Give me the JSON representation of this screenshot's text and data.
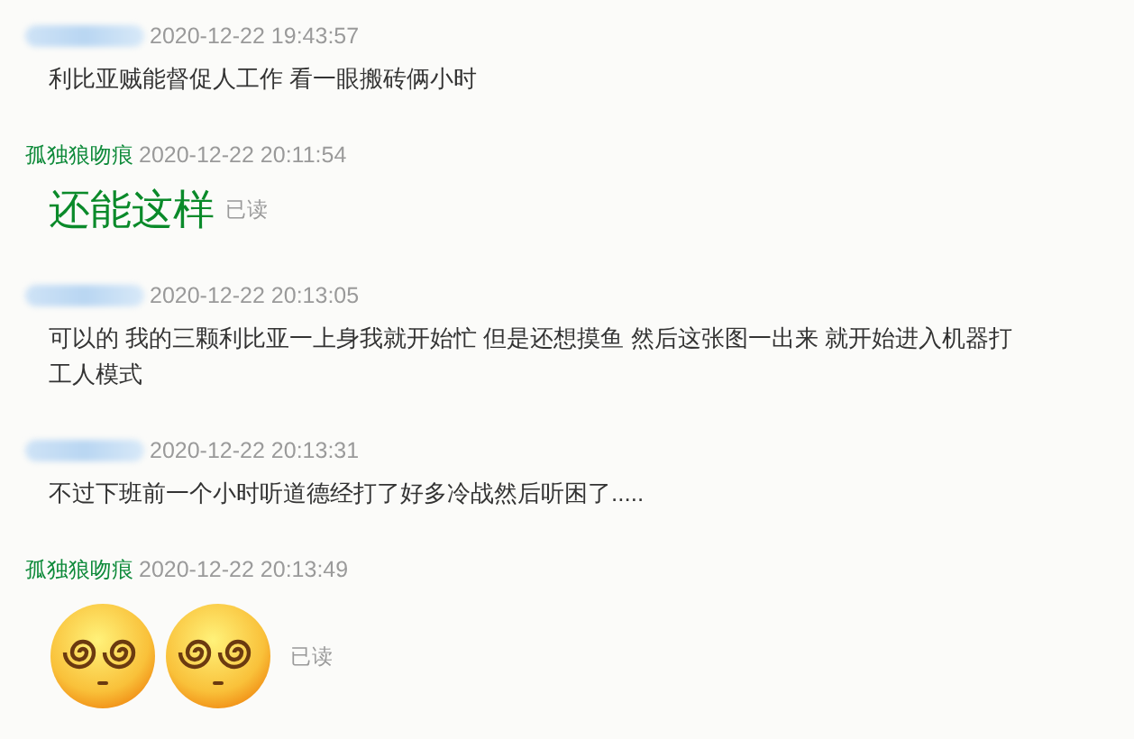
{
  "messages": [
    {
      "sender": {
        "kind": "hidden"
      },
      "time": "2020-12-22 19:43:57",
      "content": {
        "kind": "text",
        "text": "利比亚贼能督促人工作 看一眼搬砖俩小时"
      }
    },
    {
      "sender": {
        "kind": "named",
        "name": "孤独狼吻痕"
      },
      "time": "2020-12-22 20:11:54",
      "content": {
        "kind": "large",
        "text": "还能这样"
      },
      "receipt": "已读"
    },
    {
      "sender": {
        "kind": "hidden"
      },
      "time": "2020-12-22 20:13:05",
      "content": {
        "kind": "text",
        "text": "可以的 我的三颗利比亚一上身我就开始忙 但是还想摸鱼 然后这张图一出来 就开始进入机器打工人模式"
      }
    },
    {
      "sender": {
        "kind": "hidden"
      },
      "time": "2020-12-22 20:13:31",
      "content": {
        "kind": "text",
        "text": "不过下班前一个小时听道德经打了好多冷战然后听困了....."
      }
    },
    {
      "sender": {
        "kind": "named",
        "name": "孤独狼吻痕"
      },
      "time": "2020-12-22 20:13:49",
      "content": {
        "kind": "emoji",
        "emojis": [
          {
            "kind": "dizzy"
          },
          {
            "kind": "dizzy"
          }
        ]
      },
      "receipt": "已读"
    }
  ]
}
